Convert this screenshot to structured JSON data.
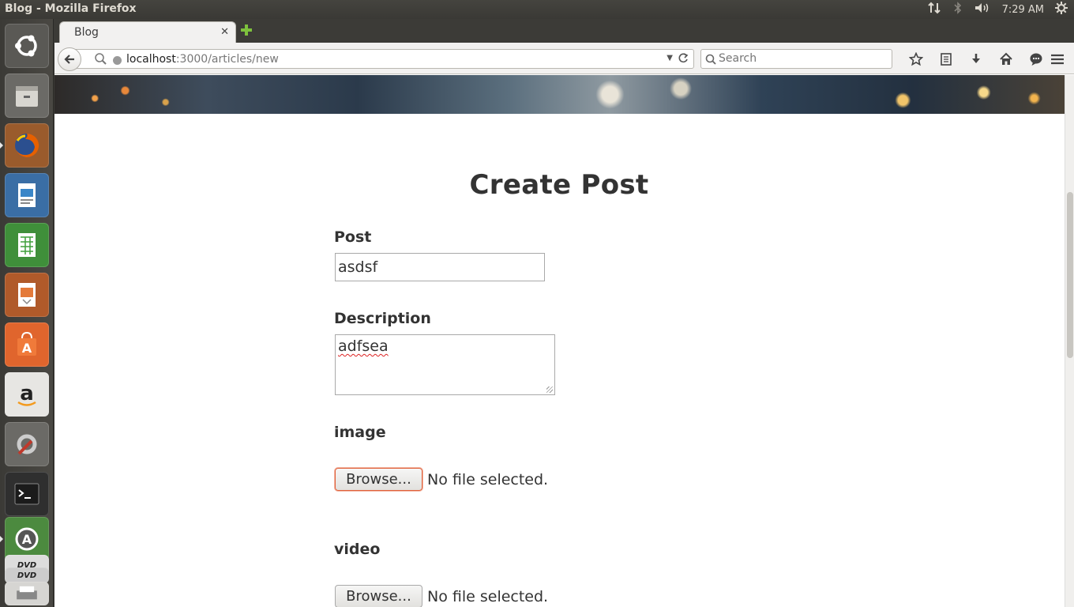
{
  "system": {
    "window_title": "Blog - Mozilla Firefox",
    "clock": "7:29 AM"
  },
  "launcher": {
    "items": [
      {
        "name": "ubuntu-dash",
        "icon": "ubuntu-logo-icon"
      },
      {
        "name": "files",
        "icon": "file-cabinet-icon"
      },
      {
        "name": "firefox",
        "icon": "firefox-icon"
      },
      {
        "name": "libreoffice-writer",
        "icon": "writer-icon"
      },
      {
        "name": "libreoffice-calc",
        "icon": "calc-icon"
      },
      {
        "name": "libreoffice-impress",
        "icon": "impress-icon"
      },
      {
        "name": "software-center",
        "icon": "software-center-icon"
      },
      {
        "name": "amazon",
        "icon": "amazon-icon"
      },
      {
        "name": "system-settings",
        "icon": "settings-icon"
      },
      {
        "name": "terminal",
        "icon": "terminal-icon"
      },
      {
        "name": "software-updater",
        "icon": "updater-icon"
      },
      {
        "name": "dvd-1",
        "icon": "dvd-icon",
        "label": "DVD"
      },
      {
        "name": "dvd-2",
        "icon": "dvd-icon",
        "label": "DVD"
      },
      {
        "name": "printer",
        "icon": "printer-icon"
      }
    ]
  },
  "browser": {
    "tab_title": "Blog",
    "url_host": "localhost",
    "url_path": ":3000/articles/new",
    "search_placeholder": "Search"
  },
  "form": {
    "heading": "Create Post",
    "post_label": "Post",
    "post_value": "asdsf",
    "description_label": "Description",
    "description_value": "adfsea",
    "image_label": "image",
    "video_label": "video",
    "browse_label": "Browse...",
    "no_file_text": "No file selected."
  },
  "colors": {
    "panel": "#3c3b37",
    "focus_accent": "#e0603a"
  }
}
